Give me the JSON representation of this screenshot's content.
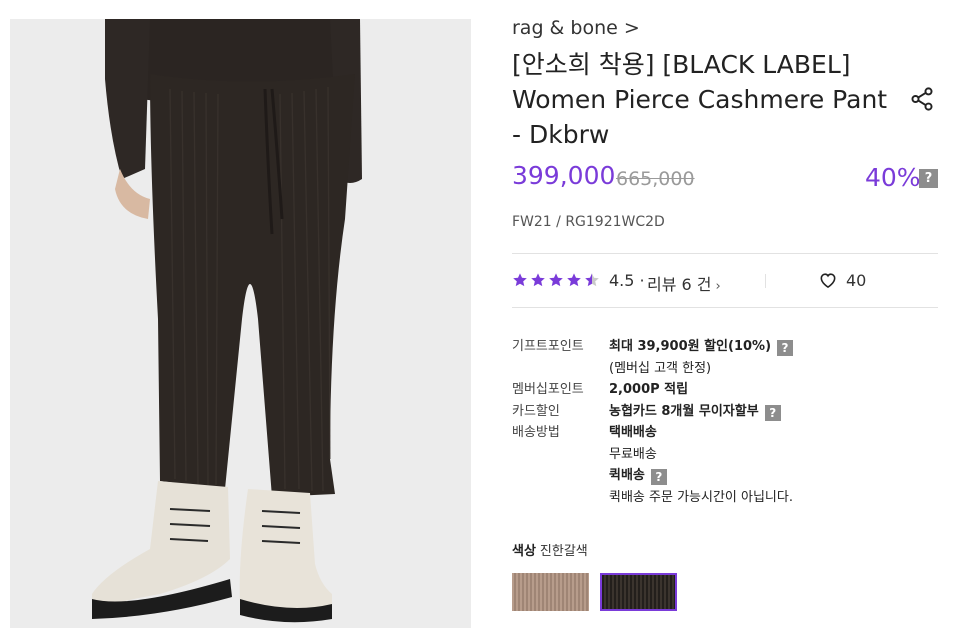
{
  "product": {
    "brand": "rag & bone >",
    "title": "[안소희 착용]  [BLACK LABEL] Women Pierce Cashmere Pant - Dkbrw",
    "price": "399,000",
    "original_price": "665,000",
    "discount": "40%",
    "code": "FW21 / RG1921WC2D"
  },
  "rating": {
    "score": "4.5 ·",
    "review_text": "리뷰  6 건",
    "stars_filled": 4.5,
    "likes": "40"
  },
  "benefits": [
    {
      "label": "기프트포인트",
      "value": "최대 39,900원 할인(10%)",
      "bold": true,
      "help": true
    },
    {
      "label": "",
      "value": "(멤버십 고객 한정)",
      "bold": false,
      "help": false
    },
    {
      "label": "멤버십포인트",
      "value": "2,000P 적립",
      "bold": true,
      "help": false
    },
    {
      "label": "카드할인",
      "value": "농협카드 8개월 무이자할부",
      "bold": true,
      "help": true
    },
    {
      "label": "배송방법",
      "value": "택배배송",
      "bold": true,
      "help": false
    },
    {
      "label": "",
      "value": "무료배송",
      "bold": false,
      "help": false
    },
    {
      "label": "",
      "value": "퀵배송",
      "bold": true,
      "help": true
    },
    {
      "label": "",
      "value": "퀵배송 주문 가능시간이 아닙니다.",
      "bold": false,
      "help": false
    }
  ],
  "color": {
    "label": "색상",
    "value": "진한갈색",
    "swatches": [
      "beige",
      "dark-brown"
    ],
    "selected": "dark-brown"
  },
  "help_glyph": "?",
  "colors": {
    "accent": "#7a3bd9",
    "help_bg": "#8d8d8d",
    "divider": "#e2e2e2"
  },
  "icons": [
    "share-icon",
    "star-icon",
    "heart-icon",
    "chevron-right-icon",
    "help-icon"
  ]
}
